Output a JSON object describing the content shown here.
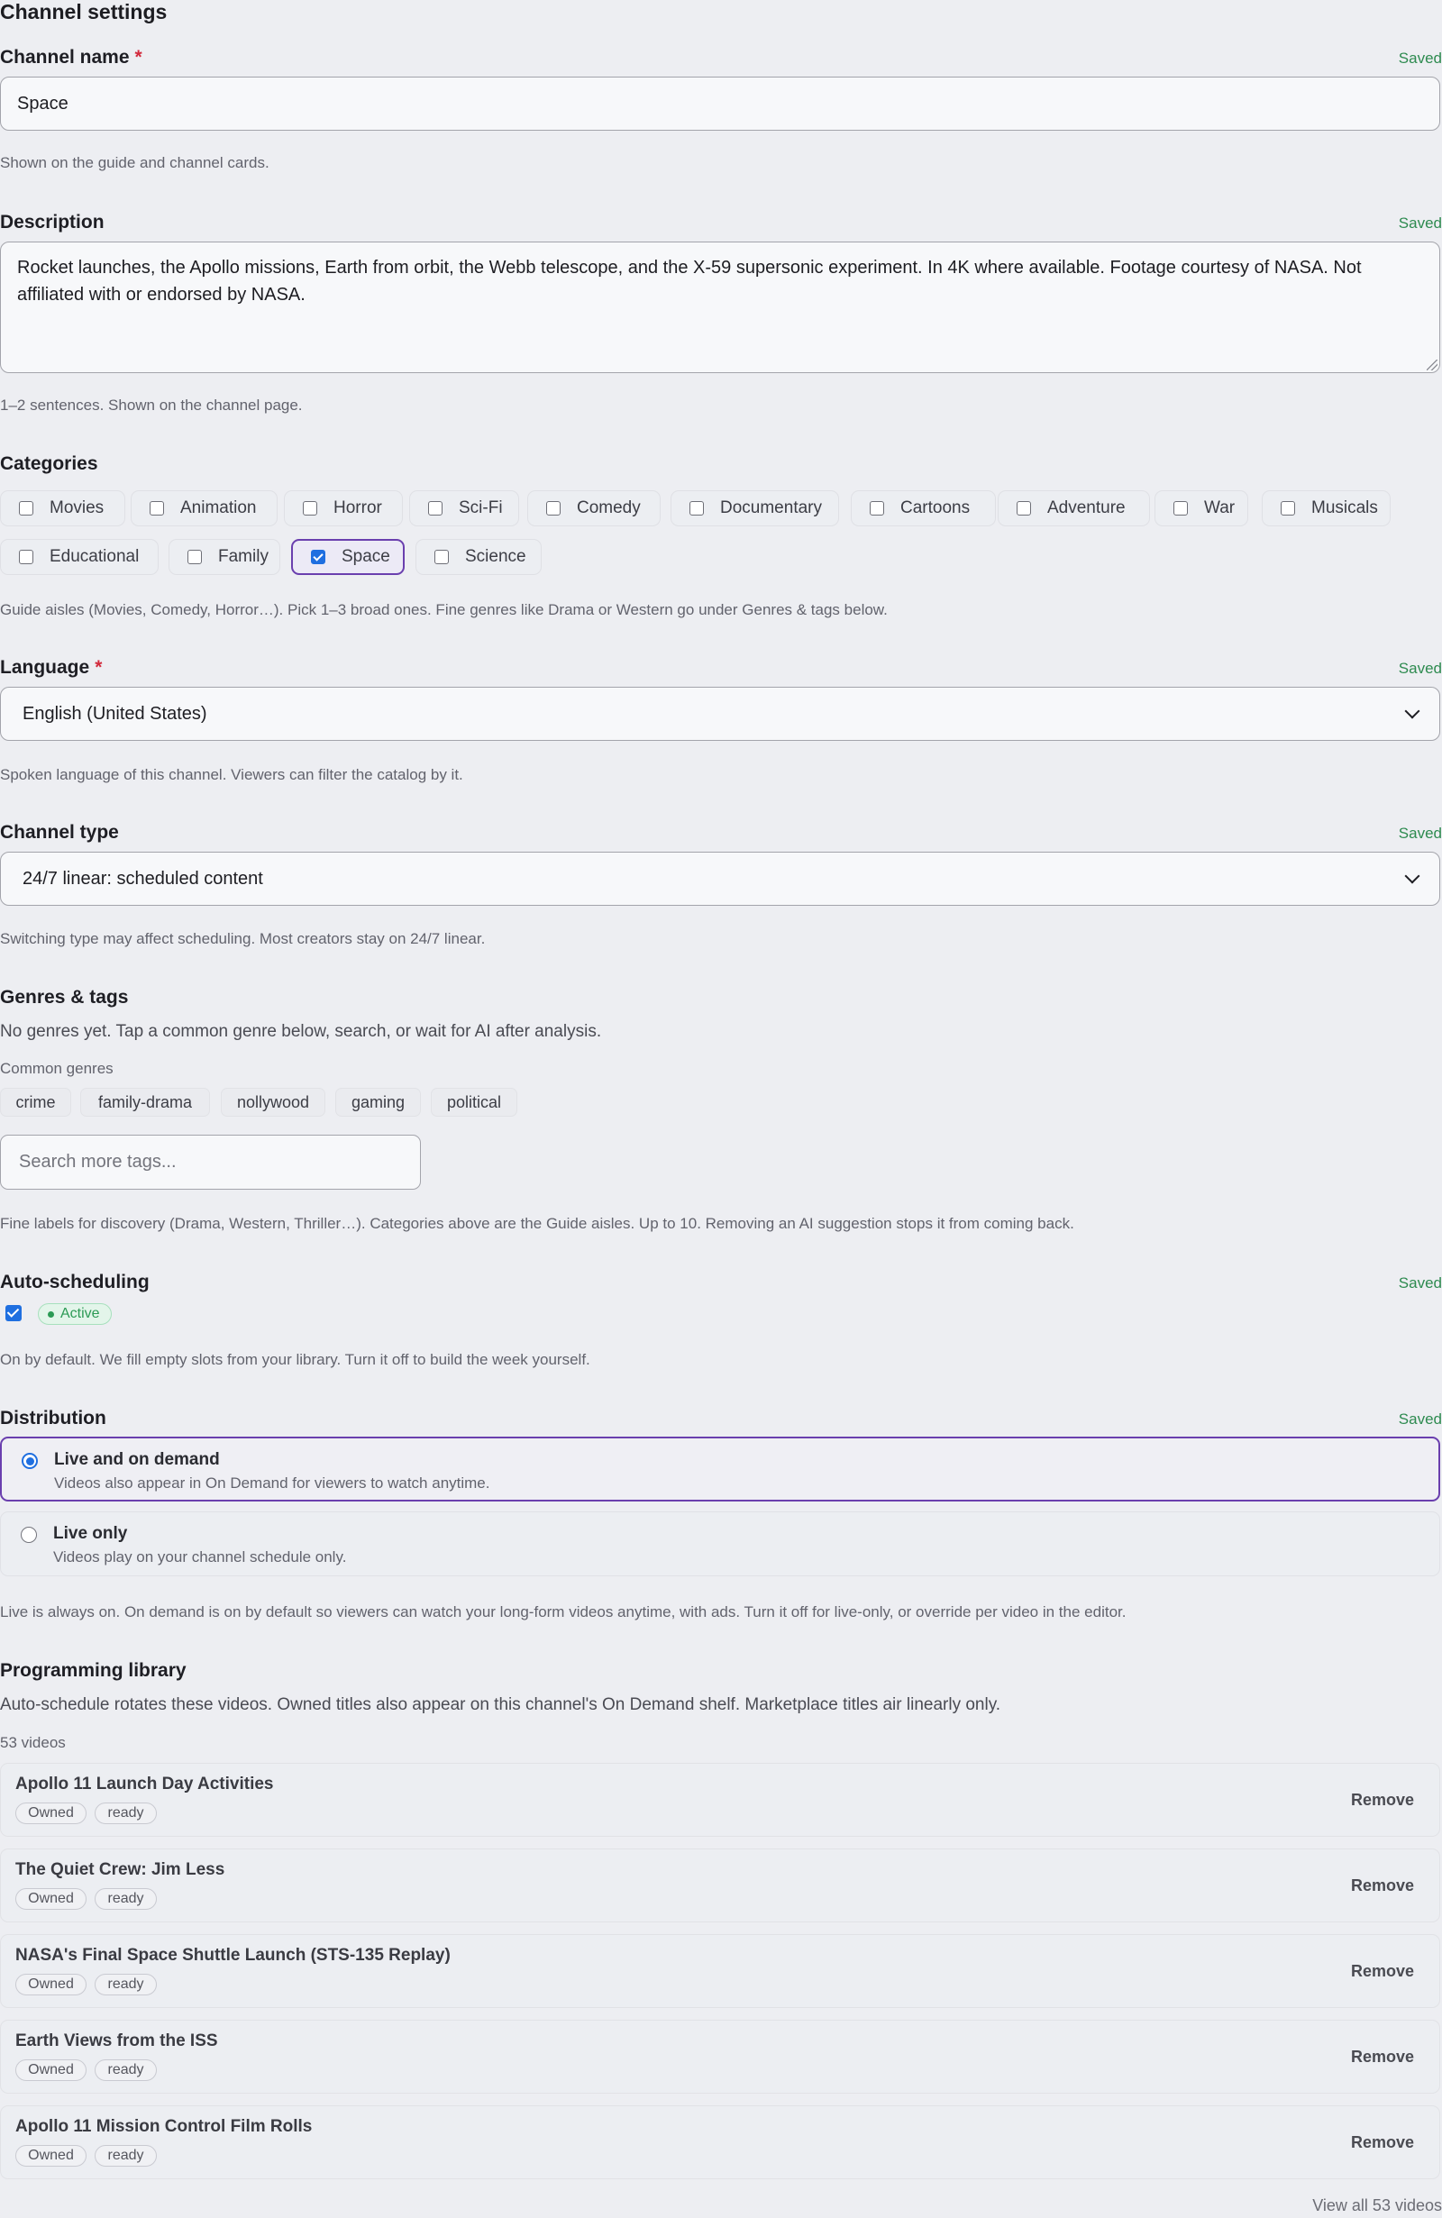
{
  "page_title": "Channel settings",
  "saved_label": "Saved",
  "required_mark": "*",
  "channel_name": {
    "label": "Channel name",
    "value": "Space",
    "help": "Shown on the guide and channel cards."
  },
  "description": {
    "label": "Description",
    "value": "Rocket launches, the Apollo missions, Earth from orbit, the Webb telescope, and the X-59 supersonic experiment. In 4K where available. Footage courtesy of NASA. Not affiliated with or endorsed by NASA.",
    "help": "1–2 sentences. Shown on the channel page."
  },
  "categories": {
    "label": "Categories",
    "items": [
      {
        "label": "Movies",
        "checked": false
      },
      {
        "label": "Animation",
        "checked": false
      },
      {
        "label": "Horror",
        "checked": false
      },
      {
        "label": "Sci-Fi",
        "checked": false
      },
      {
        "label": "Comedy",
        "checked": false
      },
      {
        "label": "Documentary",
        "checked": false
      },
      {
        "label": "Cartoons",
        "checked": false
      },
      {
        "label": "Adventure",
        "checked": false
      },
      {
        "label": "War",
        "checked": false
      },
      {
        "label": "Musicals",
        "checked": false
      },
      {
        "label": "Educational",
        "checked": false
      },
      {
        "label": "Family",
        "checked": false
      },
      {
        "label": "Space",
        "checked": true
      },
      {
        "label": "Science",
        "checked": false
      }
    ],
    "help": "Guide aisles (Movies, Comedy, Horror…). Pick 1–3 broad ones. Fine genres like Drama or Western go under Genres & tags below."
  },
  "language": {
    "label": "Language",
    "value": "English (United States)",
    "help": "Spoken language of this channel. Viewers can filter the catalog by it."
  },
  "channel_type": {
    "label": "Channel type",
    "value": "24/7 linear: scheduled content",
    "help": "Switching type may affect scheduling. Most creators stay on 24/7 linear."
  },
  "genres": {
    "label": "Genres & tags",
    "empty_text": "No genres yet. Tap a common genre below, search, or wait for AI after analysis.",
    "common_label": "Common genres",
    "common": [
      "crime",
      "family-drama",
      "nollywood",
      "gaming",
      "political"
    ],
    "search_placeholder": "Search more tags...",
    "help": "Fine labels for discovery (Drama, Western, Thriller…). Categories above are the Guide aisles. Up to 10. Removing an AI suggestion stops it from coming back."
  },
  "auto_scheduling": {
    "label": "Auto-scheduling",
    "checked": true,
    "badge": "Active",
    "help": "On by default. We fill empty slots from your library. Turn it off to build the week yourself."
  },
  "distribution": {
    "label": "Distribution",
    "options": [
      {
        "title": "Live and on demand",
        "desc": "Videos also appear in On Demand for viewers to watch anytime.",
        "selected": true
      },
      {
        "title": "Live only",
        "desc": "Videos play on your channel schedule only.",
        "selected": false
      }
    ],
    "help": "Live is always on. On demand is on by default so viewers can watch your long-form videos anytime, with ads. Turn it off for live-only, or override per video in the editor."
  },
  "library": {
    "label": "Programming library",
    "desc": "Auto-schedule rotates these videos. Owned titles also appear on this channel's On Demand shelf. Marketplace titles air linearly only.",
    "count": "53 videos",
    "remove_label": "Remove",
    "videos": [
      {
        "title": "Apollo 11 Launch Day Activities",
        "tags": [
          "Owned",
          "ready"
        ]
      },
      {
        "title": "The Quiet Crew: Jim Less",
        "tags": [
          "Owned",
          "ready"
        ]
      },
      {
        "title": "NASA's Final Space Shuttle Launch (STS-135 Replay)",
        "tags": [
          "Owned",
          "ready"
        ]
      },
      {
        "title": "Earth Views from the ISS",
        "tags": [
          "Owned",
          "ready"
        ]
      },
      {
        "title": "Apollo 11 Mission Control Film Rolls",
        "tags": [
          "Owned",
          "ready"
        ]
      }
    ],
    "view_all": "View all 53 videos"
  },
  "colors": {
    "background": "#edeef2",
    "accent_purple": "#6a3fae",
    "check_blue": "#1f6fe0",
    "saved_green": "#2e8b50",
    "required_red": "#d22a3c"
  }
}
